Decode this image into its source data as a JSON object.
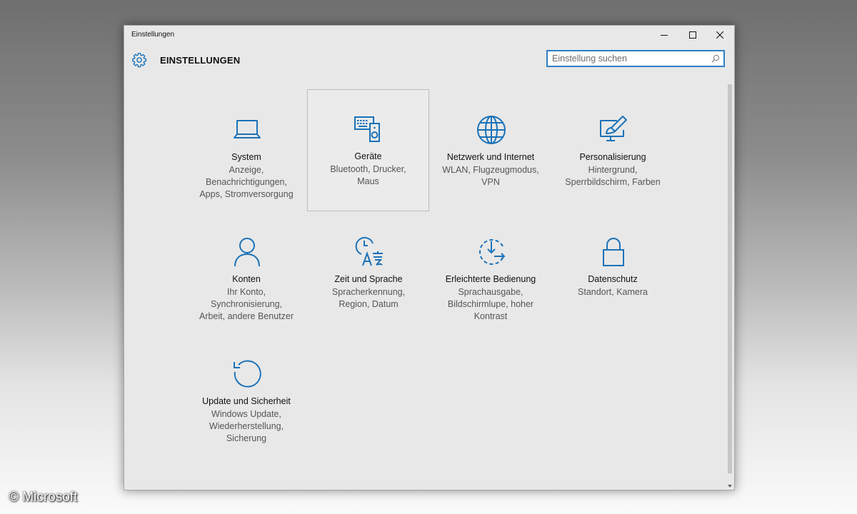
{
  "window": {
    "title": "Einstellungen"
  },
  "header": {
    "title": "EINSTELLUNGEN",
    "icon": "gear-icon"
  },
  "search": {
    "placeholder": "Einstellung suchen"
  },
  "accent": "#1b72b8",
  "tiles": [
    {
      "name": "System",
      "desc1": "Anzeige,",
      "desc2": "Benachrichtigungen,",
      "desc3": "Apps, Stromversorgung",
      "icon": "laptop-icon"
    },
    {
      "name": "Geräte",
      "desc1": "Bluetooth, Drucker,",
      "desc2": "Maus",
      "desc3": "",
      "icon": "devices-icon"
    },
    {
      "name": "Netzwerk und Internet",
      "desc1": "WLAN, Flugzeugmodus,",
      "desc2": "VPN",
      "desc3": "",
      "icon": "globe-icon"
    },
    {
      "name": "Personalisierung",
      "desc1": "Hintergrund,",
      "desc2": "Sperrbildschirm, Farben",
      "desc3": "",
      "icon": "personalize-icon"
    },
    {
      "name": "Konten",
      "desc1": "Ihr Konto,",
      "desc2": "Synchronisierung,",
      "desc3": "Arbeit, andere Benutzer",
      "icon": "person-icon"
    },
    {
      "name": "Zeit und Sprache",
      "desc1": "Spracherkennung,",
      "desc2": "Region, Datum",
      "desc3": "",
      "icon": "time-language-icon"
    },
    {
      "name": "Erleichterte Bedienung",
      "desc1": "Sprachausgabe,",
      "desc2": "Bildschirmlupe, hoher",
      "desc3": "Kontrast",
      "icon": "ease-of-access-icon"
    },
    {
      "name": "Datenschutz",
      "desc1": "Standort, Kamera",
      "desc2": "",
      "desc3": "",
      "icon": "lock-icon"
    },
    {
      "name": "Update und Sicherheit",
      "desc1": "Windows Update,",
      "desc2": "Wiederherstellung,",
      "desc3": "Sicherung",
      "icon": "update-icon"
    }
  ],
  "copyright": "© Microsoft"
}
